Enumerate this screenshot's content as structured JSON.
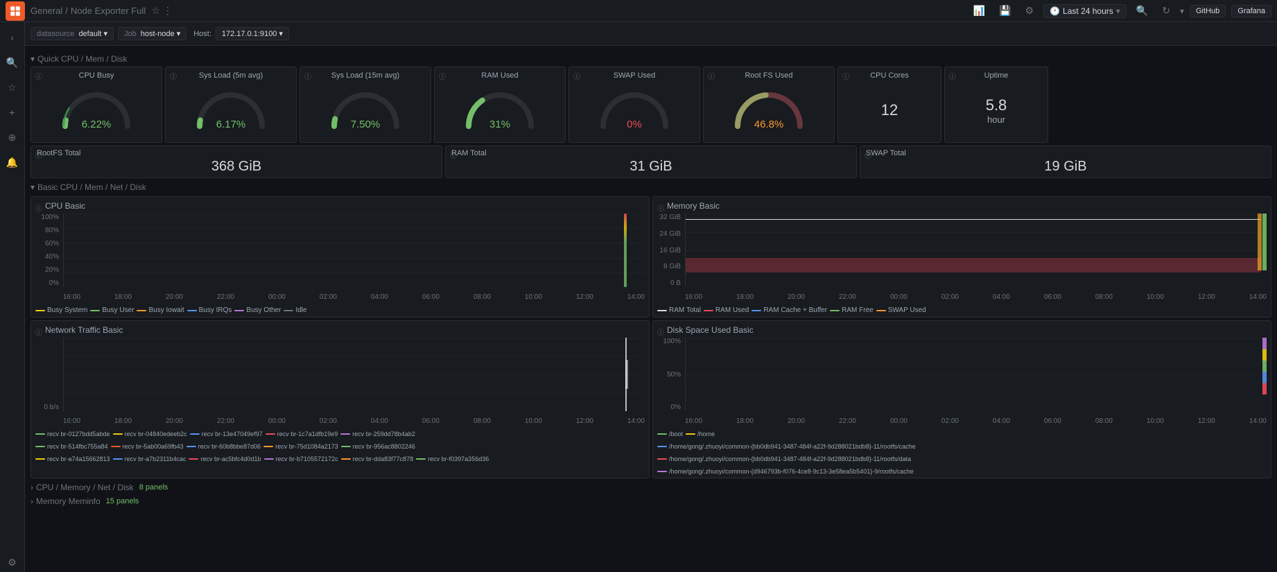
{
  "topbar": {
    "logo": "G",
    "breadcrumb_1": "General",
    "breadcrumb_sep": "/",
    "breadcrumb_2": "Node Exporter Full",
    "right_buttons": {
      "time_range": "Last 24 hours",
      "github": "GitHub",
      "grafana": "Grafana"
    }
  },
  "filterbar": {
    "datasource_label": "datasource",
    "datasource_value": "default",
    "job_label": "Job",
    "job_value": "host-node",
    "host_label": "Host:",
    "host_value": "172.17.0.1:9100"
  },
  "sections": {
    "quick_cpu": {
      "label": "Quick CPU / Mem / Disk",
      "stats": [
        {
          "id": "cpu-busy",
          "title": "CPU Busy",
          "value": "6.22%",
          "color": "green",
          "percent": 6.22
        },
        {
          "id": "sys-load-5m",
          "title": "Sys Load (5m avg)",
          "value": "6.17%",
          "color": "green",
          "percent": 6.17
        },
        {
          "id": "sys-load-15m",
          "title": "Sys Load (15m avg)",
          "value": "7.50%",
          "color": "green",
          "percent": 7.5
        },
        {
          "id": "ram-used",
          "title": "RAM Used",
          "value": "31%",
          "color": "green",
          "percent": 31
        },
        {
          "id": "swap-used",
          "title": "SWAP Used",
          "value": "0%",
          "color": "red",
          "percent": 0
        },
        {
          "id": "root-fs-used",
          "title": "Root FS Used",
          "value": "46.8%",
          "color": "red",
          "percent": 46.8
        }
      ],
      "num_stats": [
        {
          "id": "cpu-cores",
          "title": "CPU Cores",
          "value": "12",
          "unit": ""
        },
        {
          "id": "uptime",
          "title": "Uptime",
          "value": "5.8",
          "unit": "hour"
        }
      ],
      "info_stats": [
        {
          "id": "rootfs-total",
          "title": "RootFS Total",
          "value": "368 GiB"
        },
        {
          "id": "ram-total",
          "title": "RAM Total",
          "value": "31 GiB"
        },
        {
          "id": "swap-total",
          "title": "SWAP Total",
          "value": "19 GiB"
        }
      ]
    },
    "basic_cpu": {
      "label": "Basic CPU / Mem / Net / Disk",
      "cpu_chart": {
        "title": "CPU Basic",
        "y_labels": [
          "100%",
          "80%",
          "60%",
          "40%",
          "20%",
          "0%"
        ],
        "x_labels": [
          "16:00",
          "18:00",
          "20:00",
          "22:00",
          "00:00",
          "02:00",
          "04:00",
          "06:00",
          "08:00",
          "10:00",
          "12:00",
          "14:00"
        ],
        "legend": [
          {
            "label": "Busy System",
            "color": "#f2cc0c"
          },
          {
            "label": "Busy User",
            "color": "#73bf69"
          },
          {
            "label": "Busy Iowait",
            "color": "#ff9830"
          },
          {
            "label": "Busy IRQs",
            "color": "#5794f2"
          },
          {
            "label": "Busy Other",
            "color": "#b877d9"
          },
          {
            "label": "Idle",
            "color": "#6c737a"
          }
        ]
      },
      "mem_chart": {
        "title": "Memory Basic",
        "y_labels": [
          "32 GiB",
          "24 GiB",
          "16 GiB",
          "8 GiB",
          "0 B"
        ],
        "x_labels": [
          "16:00",
          "18:00",
          "20:00",
          "22:00",
          "00:00",
          "02:00",
          "04:00",
          "06:00",
          "08:00",
          "10:00",
          "12:00",
          "14:00"
        ],
        "legend": [
          {
            "label": "RAM Total",
            "color": "#d8d9da"
          },
          {
            "label": "RAM Used",
            "color": "#f2495c"
          },
          {
            "label": "RAM Cache + Buffer",
            "color": "#5794f2"
          },
          {
            "label": "RAM Free",
            "color": "#73bf69"
          },
          {
            "label": "SWAP Used",
            "color": "#ff9830"
          }
        ]
      },
      "net_chart": {
        "title": "Network Traffic Basic",
        "y_labels": [
          "",
          "",
          "",
          "",
          "0 b/s"
        ],
        "x_labels": [
          "16:00",
          "18:00",
          "20:00",
          "22:00",
          "00:00",
          "02:00",
          "04:00",
          "06:00",
          "08:00",
          "10:00",
          "12:00",
          "14:00"
        ],
        "legend": [
          {
            "label": "recv br-0127bdd5abde",
            "color": "#73bf69"
          },
          {
            "label": "recv br-04840edeeb2c",
            "color": "#f2cc0c"
          },
          {
            "label": "recv br-13e47049ef97",
            "color": "#5794f2"
          },
          {
            "label": "recv br-1c7a1dfb19e9",
            "color": "#f2495c"
          },
          {
            "label": "recv br-259dd78b4ab2",
            "color": "#b877d9"
          },
          {
            "label": "recv br-514fbc755a84",
            "color": "#73bf69"
          },
          {
            "label": "recv br-5ab00a69fb43",
            "color": "#f05a28"
          },
          {
            "label": "recv br-60b8bbe87d06",
            "color": "#5794f2"
          },
          {
            "label": "recv br-75d1084a2173",
            "color": "#ff9830"
          },
          {
            "label": "recv br-956ac8802246",
            "color": "#73bf69"
          },
          {
            "label": "recv br-a74a15662813",
            "color": "#f2cc0c"
          },
          {
            "label": "recv br-a7b2311b4cac",
            "color": "#5794f2"
          },
          {
            "label": "recv br-ac5bfc4d0d1b",
            "color": "#f2495c"
          },
          {
            "label": "recv br-b7105572172c",
            "color": "#b877d9"
          },
          {
            "label": "recv br-dda83f77c878",
            "color": "#ff9830"
          },
          {
            "label": "recv br-f0397a356d36",
            "color": "#73bf69"
          }
        ]
      },
      "disk_chart": {
        "title": "Disk Space Used Basic",
        "y_labels": [
          "100%",
          "50%",
          "0%"
        ],
        "x_labels": [
          "16:00",
          "18:00",
          "20:00",
          "22:00",
          "00:00",
          "02:00",
          "04:00",
          "06:00",
          "08:00",
          "10:00",
          "12:00",
          "14:00"
        ],
        "legend": [
          {
            "label": "/boot",
            "color": "#73bf69"
          },
          {
            "label": "/home",
            "color": "#f2cc0c"
          },
          {
            "label": "/home/gong/.zhuoyi/common-{bb0db941-3487-484f-a22f-9d288021bdb8}-11/rootfs/cache",
            "color": "#5794f2"
          },
          {
            "label": "/home/gong/.zhuoyi/common-{bb0db941-3487-484f-a22f-9d288021bdb8}-11/rootfs/data",
            "color": "#f2495c"
          },
          {
            "label": "/home/gong/.zhuoyi/common-{d946793b-f076-4ce8-9c13-3e58ea5b5401}-9/rootfs/cache",
            "color": "#b877d9"
          }
        ]
      }
    },
    "cpu_memory_net_disk": {
      "label": "CPU / Memory / Net / Disk",
      "panels_count": "8 panels"
    },
    "memory_meminfo": {
      "label": "Memory Meminfo",
      "panels_count": "15 panels"
    }
  }
}
